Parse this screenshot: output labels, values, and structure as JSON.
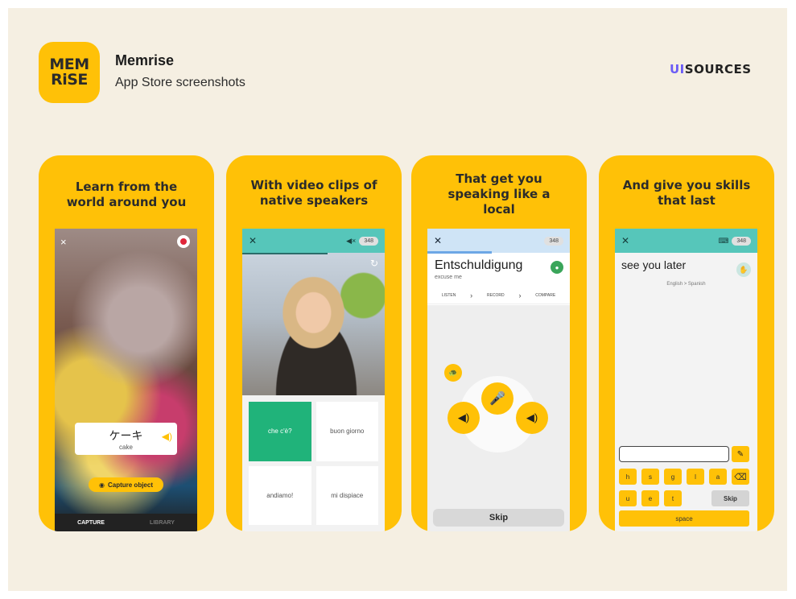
{
  "header": {
    "logo_lines": [
      "MEM",
      "RiSE"
    ],
    "app_name": "Memrise",
    "subtitle": "App Store screenshots",
    "brand_ui": "UI",
    "brand_rest": "SOURCES"
  },
  "colors": {
    "accent": "#ffc107",
    "background": "#f5efe2",
    "teal": "#56c6ba",
    "correct": "#20b37a",
    "brand": "#6b5cf6"
  },
  "cards": [
    {
      "headline": "Learn from the world around you",
      "close_icon": "×",
      "label_word": "ケーキ",
      "label_translation": "cake",
      "capture_button": "Capture object",
      "tabs": [
        "CAPTURE",
        "LIBRARY"
      ]
    },
    {
      "headline": "With video clips of native speakers",
      "close_icon": "✕",
      "count": "348",
      "options": [
        "che c'è?",
        "buon giorno",
        "andiamo!",
        "mi dispiace"
      ]
    },
    {
      "headline": "That get you speaking like a local",
      "close_icon": "✕",
      "count": "348",
      "word": "Entschuldigung",
      "translation": "excuse me",
      "steps": [
        "LISTEN",
        "RECORD",
        "COMPARE"
      ],
      "skip": "Skip"
    },
    {
      "headline": "And give you skills that last",
      "close_icon": "✕",
      "count": "348",
      "phrase": "see you later",
      "language_pair": "English > Spanish",
      "keys_row1": [
        "h",
        "s",
        "g",
        "l",
        "a"
      ],
      "keys_row2": [
        "u",
        "e",
        "t"
      ],
      "skip": "Skip",
      "space": "space"
    }
  ]
}
